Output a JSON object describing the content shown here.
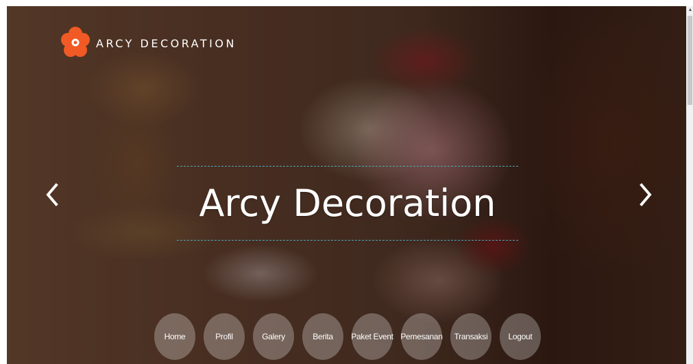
{
  "brand": {
    "name": "ARCY DECORATION",
    "logo_icon": "flower-icon",
    "logo_color": "#f15a24"
  },
  "hero": {
    "title": "Arcy Decoration",
    "line_color": "#4fa7b8"
  },
  "carousel": {
    "prev_icon": "chevron-left-icon",
    "next_icon": "chevron-right-icon"
  },
  "nav": {
    "items": [
      "Home",
      "Profil",
      "Galery",
      "Berita",
      "Paket Event",
      "Pemesanan",
      "Transaksi",
      "Logout"
    ]
  }
}
